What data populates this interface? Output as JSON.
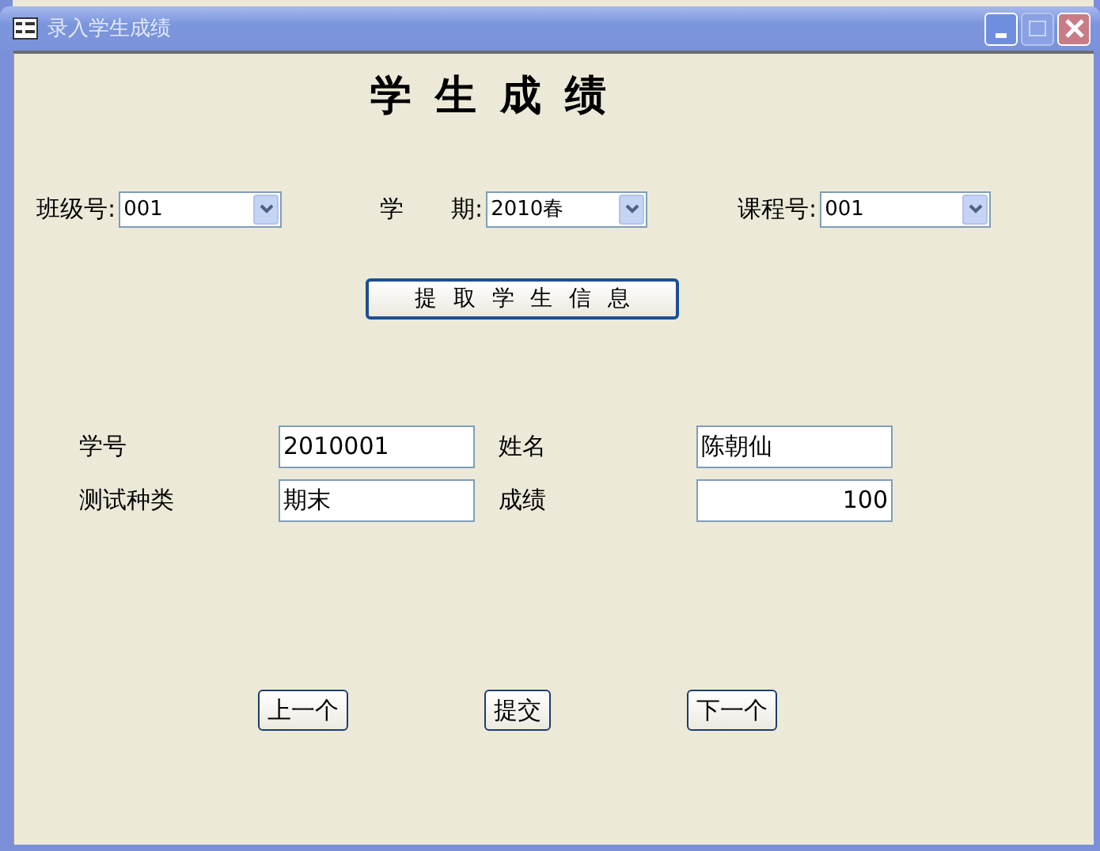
{
  "window": {
    "title": "录入学生成绩"
  },
  "heading": "学 生 成 绩",
  "filters": [
    {
      "label": "班级号:",
      "value": "001"
    },
    {
      "label": "学　　期:",
      "value": "2010春"
    },
    {
      "label": "课程号:",
      "value": "001"
    }
  ],
  "fetch_button": "提 取 学 生 信 息",
  "fields": [
    {
      "label": "学号",
      "value": "2010001",
      "kind": "text"
    },
    {
      "label": "姓名",
      "value": "陈朝仙",
      "kind": "text"
    },
    {
      "label": "测试种类",
      "value": "期末",
      "kind": "text"
    },
    {
      "label": "成绩",
      "value": "100",
      "kind": "number"
    }
  ],
  "buttons": [
    "上一个",
    "提交",
    "下一个"
  ]
}
